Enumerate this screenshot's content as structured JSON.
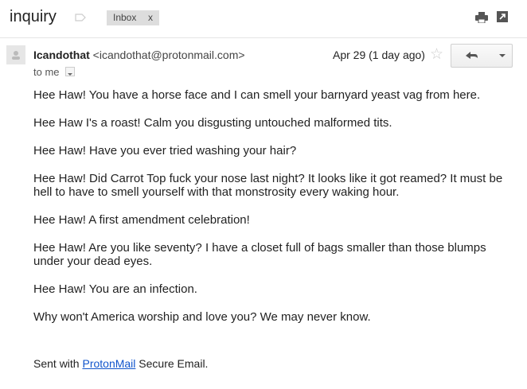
{
  "subject": "inquiry",
  "chip": {
    "label": "Inbox",
    "remove": "x"
  },
  "message": {
    "sender_name": "Icandothat",
    "sender_email": "<icandothat@protonmail.com>",
    "to": "to me",
    "date": "Apr 29 (1 day ago)",
    "star": "☆",
    "body": [
      "Hee Haw! You have a horse face and I can smell your barnyard yeast vag from here.",
      "Hee Haw  I's a roast! Calm you disgusting untouched malformed tits.",
      "Hee Haw! Have you ever tried washing your hair?",
      "Hee Haw! Did Carrot Top fuck your nose last night? It looks like it got reamed? It must be hell to have to smell yourself with that monstrosity every waking hour.",
      "Hee Haw! A first amendment celebration!",
      "Hee Haw! Are you like seventy? I have a closet full of bags smaller than those blumps under your dead eyes.",
      "Hee Haw! You are an infection.",
      "Why won't America worship and love you? We may never know."
    ],
    "signature": {
      "prefix": "Sent with ",
      "link": "ProtonMail",
      "suffix": " Secure Email."
    }
  },
  "icons": [
    "label-icon",
    "print-icon",
    "popout-icon",
    "avatar",
    "chevron-down-icon",
    "star-icon",
    "reply-icon",
    "more-dropdown-icon"
  ],
  "colors": {
    "link": "#1155cc",
    "chip_bg": "#dddddd",
    "text": "#222222"
  }
}
